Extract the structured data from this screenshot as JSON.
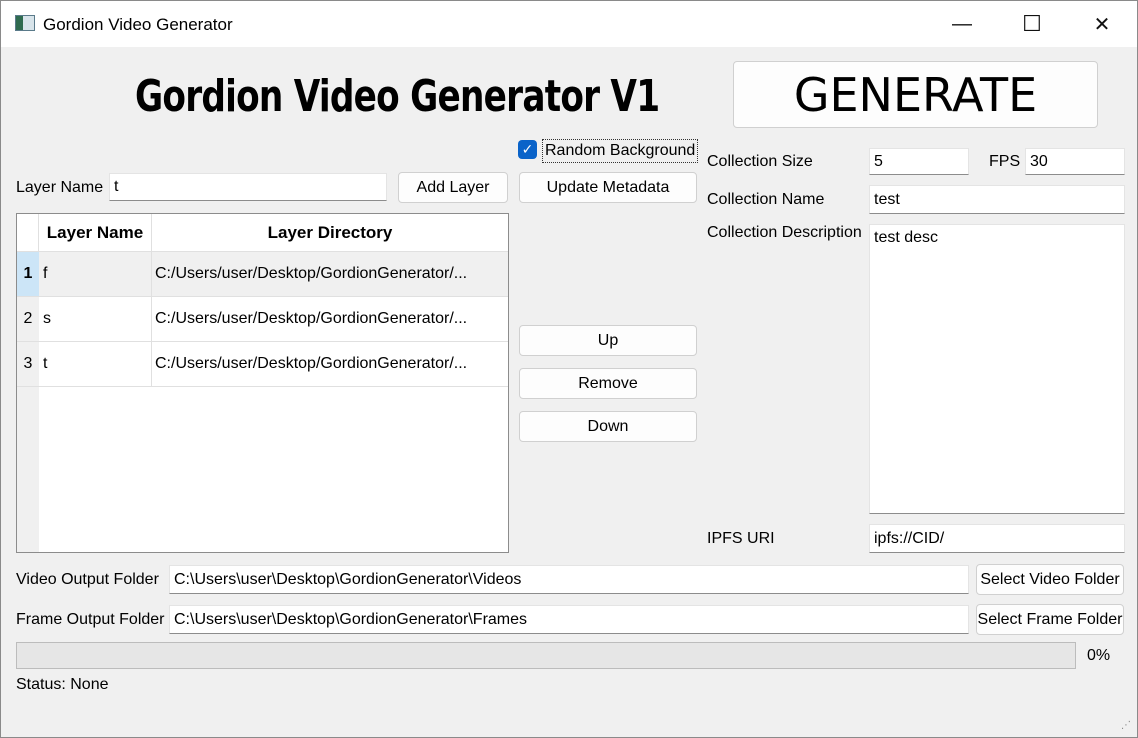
{
  "window": {
    "title": "Gordion Video Generator",
    "controls": {
      "minimize": "—",
      "maximize": "☐",
      "close": "✕"
    }
  },
  "header": {
    "app_title": "Gordion Video Generator V1",
    "generate_label": "GENERATE"
  },
  "layers": {
    "random_background_label": "Random Background",
    "random_background_checked": true,
    "layer_name_label": "Layer Name",
    "layer_name_value": "t",
    "add_layer_label": "Add Layer",
    "update_metadata_label": "Update Metadata",
    "table": {
      "headers": [
        "Layer Name",
        "Layer Directory"
      ],
      "rows": [
        {
          "num": "1",
          "name": "f",
          "dir": "C:/Users/user/Desktop/GordionGenerator/..."
        },
        {
          "num": "2",
          "name": "s",
          "dir": "C:/Users/user/Desktop/GordionGenerator/..."
        },
        {
          "num": "3",
          "name": "t",
          "dir": "C:/Users/user/Desktop/GordionGenerator/..."
        }
      ]
    },
    "up_label": "Up",
    "remove_label": "Remove",
    "down_label": "Down"
  },
  "collection": {
    "size_label": "Collection Size",
    "size_value": "5",
    "fps_label": "FPS",
    "fps_value": "30",
    "name_label": "Collection Name",
    "name_value": "test",
    "description_label": "Collection Description",
    "description_value": "test desc",
    "ipfs_label": "IPFS URI",
    "ipfs_value": "ipfs://CID/"
  },
  "output": {
    "video_label": "Video Output Folder",
    "video_value": "C:\\Users\\user\\Desktop\\GordionGenerator\\Videos",
    "select_video_label": "Select Video Folder",
    "frame_label": "Frame Output Folder",
    "frame_value": "C:\\Users\\user\\Desktop\\GordionGenerator\\Frames",
    "select_frame_label": "Select Frame Folder"
  },
  "progress": {
    "value": 0,
    "text": "0%"
  },
  "status": {
    "text": "Status: None"
  },
  "colors": {
    "accent": "#0a63c9",
    "selected_row_header": "#cce5f7"
  }
}
